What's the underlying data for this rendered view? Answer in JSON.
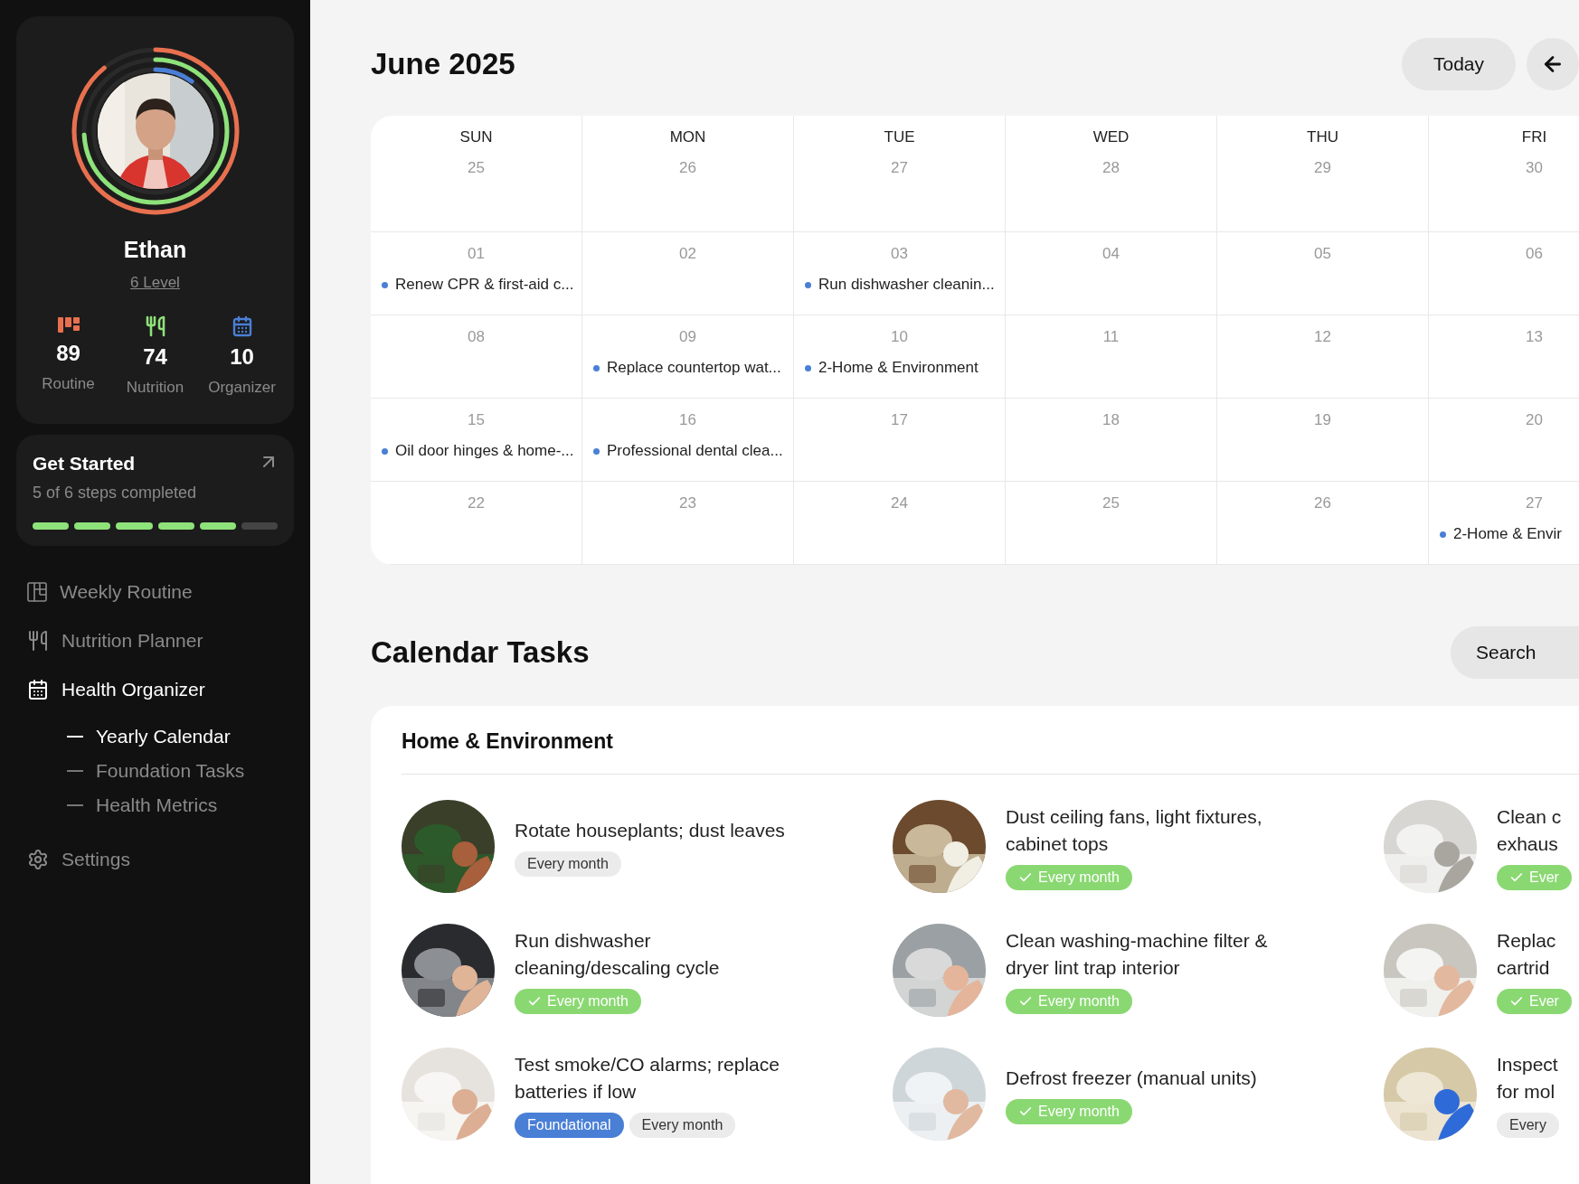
{
  "profile": {
    "name": "Ethan",
    "level_label": "6 Level",
    "stats": [
      {
        "kind": "routine",
        "value": "89",
        "label": "Routine",
        "color": "#e8704f"
      },
      {
        "kind": "nutrition",
        "value": "74",
        "label": "Nutrition",
        "color": "#8ee27a"
      },
      {
        "kind": "organizer",
        "value": "10",
        "label": "Organizer",
        "color": "#4a7fd6"
      }
    ]
  },
  "get_started": {
    "title": "Get Started",
    "subtitle": "5 of 6 steps completed",
    "steps": [
      {
        "done": true
      },
      {
        "done": true
      },
      {
        "done": true
      },
      {
        "done": true
      },
      {
        "done": true
      },
      {
        "done": false
      }
    ]
  },
  "nav": [
    {
      "kind": "grid",
      "label": "Weekly Routine",
      "selected": false
    },
    {
      "kind": "utensils",
      "label": "Nutrition Planner",
      "selected": false
    },
    {
      "kind": "calendar",
      "label": "Health Organizer",
      "selected": true,
      "children": [
        {
          "label": "Yearly Calendar",
          "selected": true
        },
        {
          "label": "Foundation Tasks",
          "selected": false
        },
        {
          "label": "Health Metrics",
          "selected": false
        }
      ]
    },
    {
      "kind": "settings",
      "label": "Settings",
      "selected": false
    }
  ],
  "calendar": {
    "title": "June 2025",
    "today_button": "Today",
    "weekdays": [
      "SUN",
      "MON",
      "TUE",
      "WED",
      "THU",
      "FRI"
    ],
    "weeks": [
      [
        {
          "day": "25"
        },
        {
          "day": "26"
        },
        {
          "day": "27"
        },
        {
          "day": "28"
        },
        {
          "day": "29"
        },
        {
          "day": "30"
        }
      ],
      [
        {
          "day": "01",
          "events": [
            "Renew CPR & first-aid c..."
          ]
        },
        {
          "day": "02"
        },
        {
          "day": "03",
          "events": [
            "Run dishwasher cleanin..."
          ]
        },
        {
          "day": "04"
        },
        {
          "day": "05"
        },
        {
          "day": "06"
        }
      ],
      [
        {
          "day": "08"
        },
        {
          "day": "09",
          "events": [
            "Replace countertop wat..."
          ]
        },
        {
          "day": "10",
          "events": [
            "2-Home & Environment"
          ]
        },
        {
          "day": "11"
        },
        {
          "day": "12"
        },
        {
          "day": "13"
        }
      ],
      [
        {
          "day": "15",
          "events": [
            "Oil door hinges & home-..."
          ]
        },
        {
          "day": "16",
          "events": [
            "Professional dental clea..."
          ]
        },
        {
          "day": "17"
        },
        {
          "day": "18"
        },
        {
          "day": "19"
        },
        {
          "day": "20"
        }
      ],
      [
        {
          "day": "22"
        },
        {
          "day": "23"
        },
        {
          "day": "24"
        },
        {
          "day": "25"
        },
        {
          "day": "26"
        },
        {
          "day": "27",
          "events": [
            "2-Home & Envir"
          ]
        }
      ]
    ]
  },
  "tasks": {
    "title": "Calendar Tasks",
    "search_button": "Search",
    "groups": [
      {
        "title": "Home & Environment",
        "items": [
          {
            "lines": [
              "Rotate houseplants; dust leaves"
            ],
            "tags": [
              {
                "kind": "plain",
                "label": "Every month"
              }
            ]
          },
          {
            "lines": [
              "Dust ceiling fans, light fixtures,",
              "cabinet tops"
            ],
            "tags": [
              {
                "kind": "done",
                "label": "Every month"
              }
            ]
          },
          {
            "lines": [
              "Clean c",
              "exhaus"
            ],
            "tags": [
              {
                "kind": "done",
                "label": "Ever"
              }
            ]
          },
          {
            "lines": [
              "Run dishwasher",
              "cleaning/descaling cycle"
            ],
            "tags": [
              {
                "kind": "done",
                "label": "Every month"
              }
            ]
          },
          {
            "lines": [
              "Clean washing-machine filter &",
              "dryer lint trap interior"
            ],
            "tags": [
              {
                "kind": "done",
                "label": "Every month"
              }
            ]
          },
          {
            "lines": [
              "Replac",
              "cartrid"
            ],
            "tags": [
              {
                "kind": "done",
                "label": "Ever"
              }
            ]
          },
          {
            "lines": [
              "Test smoke/CO alarms; replace",
              "batteries if low"
            ],
            "tags": [
              {
                "kind": "foundational",
                "label": "Foundational"
              },
              {
                "kind": "plain",
                "label": "Every month"
              }
            ]
          },
          {
            "lines": [
              "Defrost freezer (manual units)"
            ],
            "tags": [
              {
                "kind": "done",
                "label": "Every month"
              }
            ]
          },
          {
            "lines": [
              "Inspect",
              "for mol"
            ],
            "tags": [
              {
                "kind": "plain",
                "label": "Every"
              }
            ]
          }
        ]
      }
    ]
  }
}
